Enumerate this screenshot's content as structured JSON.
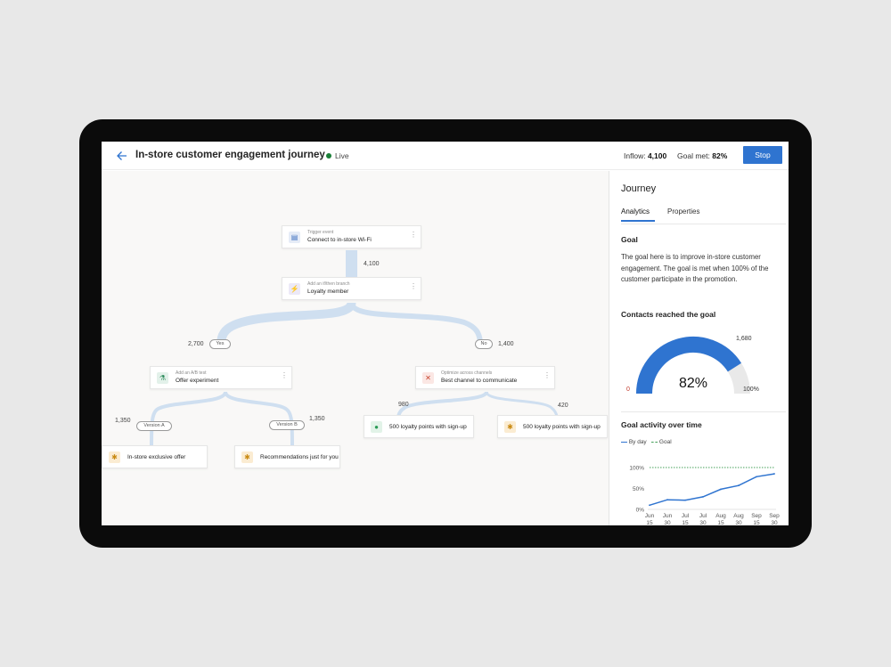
{
  "header": {
    "title": "In-store customer engagement journey",
    "status": "Live",
    "inflow_label": "Inflow:",
    "inflow_value": "4,100",
    "goal_met_label": "Goal met:",
    "goal_met_value": "82%",
    "stop_label": "Stop"
  },
  "journey": {
    "nodes": {
      "trigger": {
        "sub": "Trigger event",
        "label": "Connect to in-store Wi-Fi",
        "icon": "wifi-event-icon"
      },
      "branch": {
        "sub": "Add an if/then branch",
        "label": "Loyalty member",
        "icon": "branch-icon"
      },
      "abtest": {
        "sub": "Add an A/B test",
        "label": "Offer experiment",
        "icon": "flask-icon"
      },
      "optimize": {
        "sub": "Optimize across channels",
        "label": "Best channel to communicate",
        "icon": "channels-icon"
      },
      "instore": {
        "label": "In-store exclusive offer",
        "icon": "gift-icon"
      },
      "recs": {
        "label": "Recommendations just for you",
        "icon": "gift-icon"
      },
      "loyalty1": {
        "label": "500 loyalty points with sign-up",
        "icon": "chat-icon"
      },
      "loyalty2": {
        "label": "500 loyalty points with sign-up",
        "icon": "gift-icon"
      }
    },
    "counts": {
      "trigger_out": "4,100",
      "yes": "2,700",
      "no": "1,400",
      "version_a": "1,350",
      "version_b": "1,350",
      "channel1": "980",
      "channel2": "420"
    },
    "pills": {
      "yes": "Yes",
      "no": "No",
      "version_a": "Version A",
      "version_b": "Version B"
    }
  },
  "panel": {
    "title": "Journey",
    "tabs": [
      "Analytics",
      "Properties"
    ],
    "goal_heading": "Goal",
    "goal_text": "The goal here is to improve in-store customer engagement. The goal is met when 100% of the customer participate in the promotion.",
    "contacts_heading": "Contacts reached the goal",
    "gauge": {
      "value_label": "82%",
      "value": 0.82,
      "min_label": "0",
      "max_label": "100%",
      "top_label": "1,680"
    },
    "activity_heading": "Goal activity over time",
    "legend": {
      "by_day": "By day",
      "goal": "Goal"
    }
  },
  "colors": {
    "accent": "#2f74d0",
    "flow": "#cfdff0",
    "live": "#1a7f37",
    "goal_line": "#46a05a",
    "gauge_track": "#e9e9e9"
  },
  "chart_data": {
    "type": "line",
    "title": "Goal activity over time",
    "x": [
      "Jun 15",
      "Jun 30",
      "Jul 15",
      "Jul 30",
      "Aug 15",
      "Aug 30",
      "Sep 15",
      "Sep 30"
    ],
    "x_ticks": [
      [
        "Jun",
        "15"
      ],
      [
        "Jun",
        "30"
      ],
      [
        "Jul",
        "15"
      ],
      [
        "Jul",
        "30"
      ],
      [
        "Aug",
        "15"
      ],
      [
        "Aug",
        "30"
      ],
      [
        "Sep",
        "15"
      ],
      [
        "Sep",
        "30"
      ]
    ],
    "y_ticks": [
      "100%",
      "50%",
      "0%"
    ],
    "ylim": [
      0,
      100
    ],
    "series": [
      {
        "name": "By day",
        "values": [
          10,
          23,
          22,
          30,
          48,
          57,
          78,
          85
        ],
        "style": "solid"
      },
      {
        "name": "Goal",
        "values": [
          100,
          100,
          100,
          100,
          100,
          100,
          100,
          100
        ],
        "style": "dotted"
      }
    ]
  }
}
